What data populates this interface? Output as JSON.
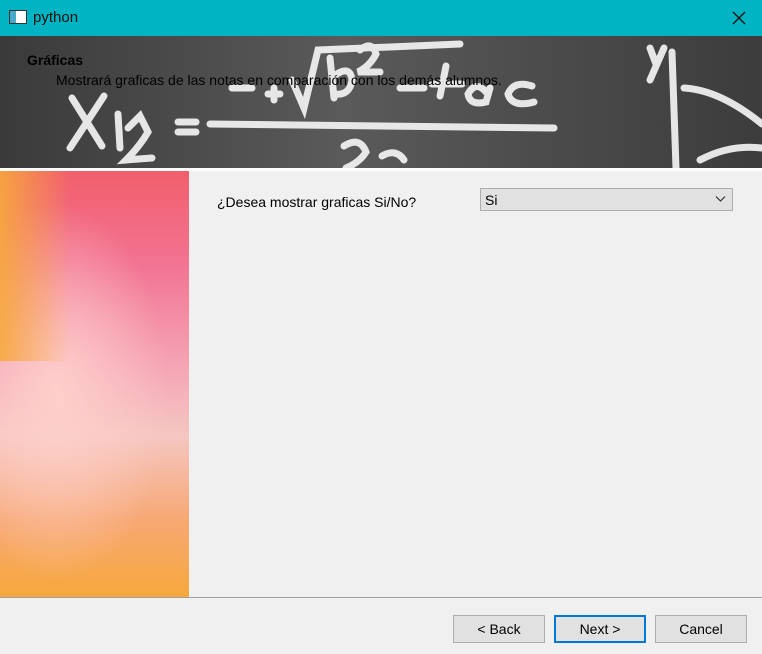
{
  "window": {
    "title": "python",
    "app_icon": "window-icon",
    "close_icon": "close-icon"
  },
  "header": {
    "title": "Gráficas",
    "subtitle": "Mostrará graficas de las notas en comparación con los demás alumnos."
  },
  "form": {
    "question_label": "¿Desea mostrar graficas Si/No?",
    "select_value": "Si",
    "select_icon": "chevron-down-icon"
  },
  "footer": {
    "back_label": "< Back",
    "next_label": "Next >",
    "cancel_label": "Cancel"
  },
  "colors": {
    "titlebar": "#00b4c4",
    "accent": "#0078d7"
  }
}
